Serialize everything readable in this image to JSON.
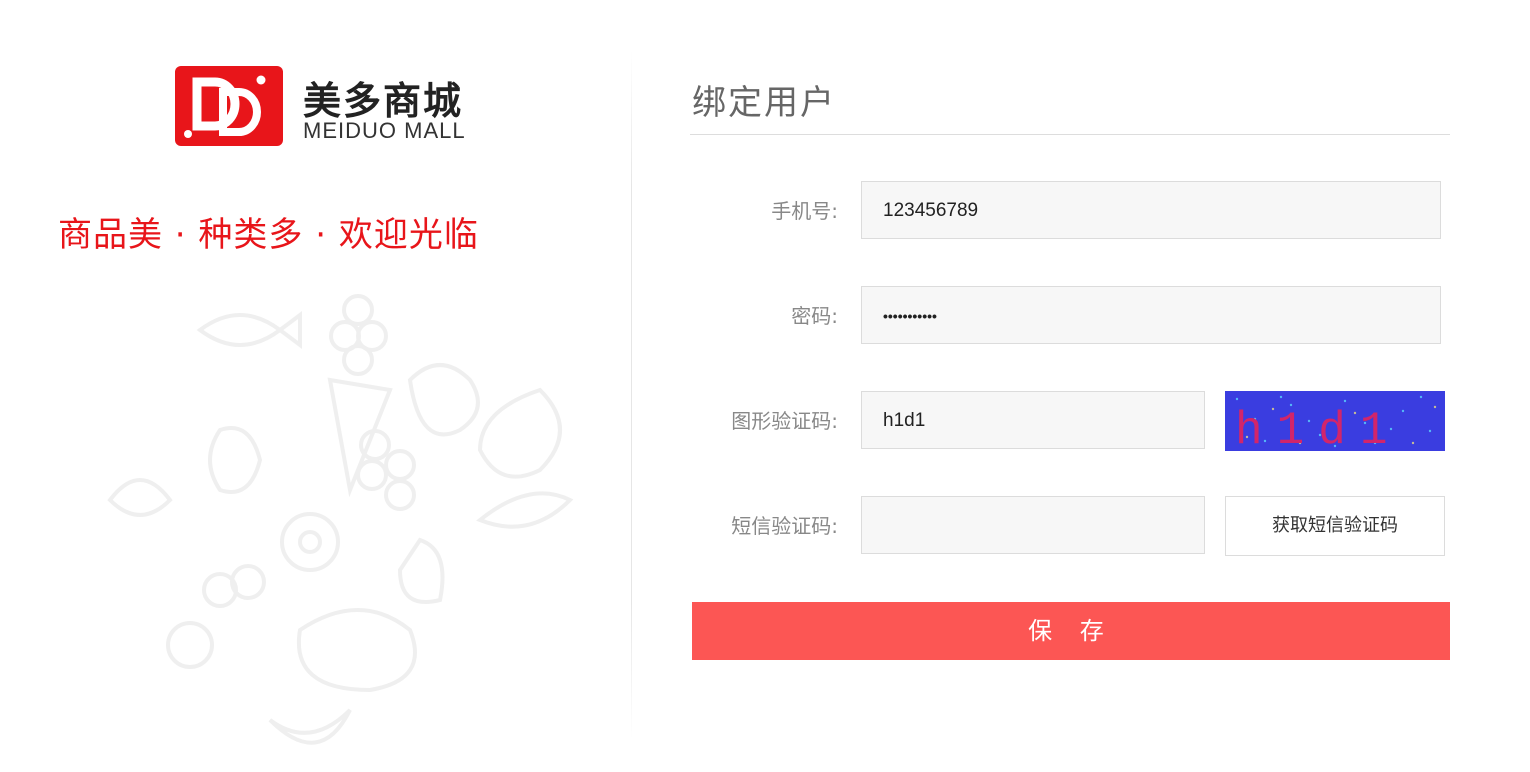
{
  "brand": {
    "name_cn": "美多商城",
    "name_en": "MEIDUO MALL",
    "slogan": "商品美 · 种类多 · 欢迎光临",
    "accent_color": "#e8151a"
  },
  "form": {
    "title": "绑定用户",
    "phone": {
      "label": "手机号:",
      "value": "123456789"
    },
    "password": {
      "label": "密码:",
      "value": "•••••••••••"
    },
    "image_code": {
      "label": "图形验证码:",
      "value": "h1d1",
      "captcha_text": "h1d1"
    },
    "sms_code": {
      "label": "短信验证码:",
      "value": "",
      "button_label": "获取短信验证码"
    },
    "submit_label": "保 存",
    "submit_color": "#fc5654"
  }
}
